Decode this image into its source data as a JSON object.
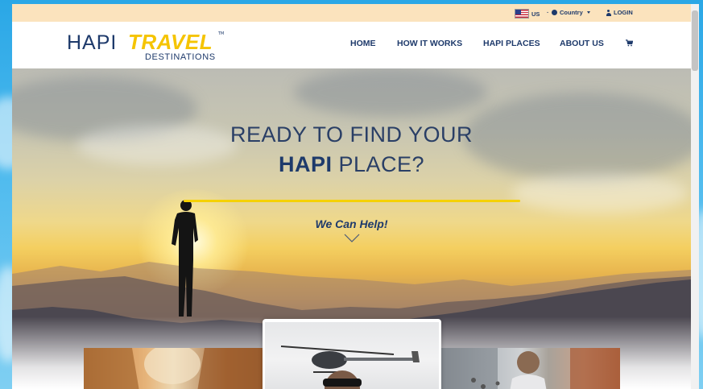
{
  "topbar": {
    "language": "US",
    "country": "Country",
    "login": "LOGIN"
  },
  "brand": {
    "logo_hapi": "HAPI",
    "logo_travel": "TRAVEL",
    "logo_destinations": "DESTINATIONS",
    "logo_tm": "TM"
  },
  "nav": {
    "items": [
      "HOME",
      "HOW IT WORKS",
      "HAPI PLACES",
      "ABOUT US"
    ],
    "cart_icon": "cart-icon"
  },
  "hero": {
    "line1": "READY TO FIND YOUR",
    "line2_bold": "HAPI",
    "line2_rest": " PLACE?",
    "tagline": "We Can Help!"
  },
  "colors": {
    "navy": "#1e3a6b",
    "yellow": "#f5c400",
    "topbar_bg": "#fbe3bd"
  }
}
